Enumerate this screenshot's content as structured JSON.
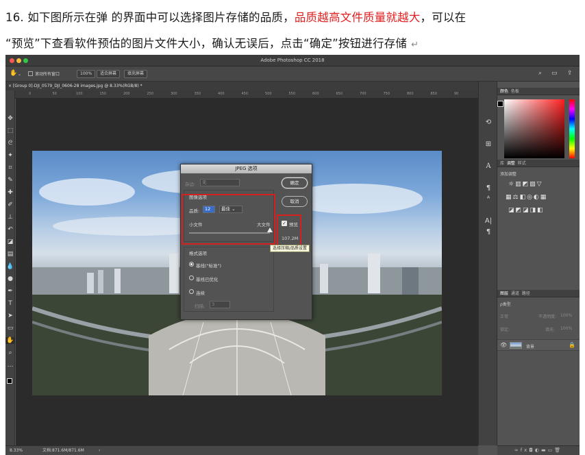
{
  "document": {
    "line1_prefix": "16. 如下图所示在弹 的界面中可以选择图片存储的品质，",
    "line1_highlight": "品质越高文件质量就越大",
    "line1_suffix": "，可以在",
    "line2": "“预览”下查看软件预估的图片文件大小，确认无误后，点击“确定”按钮进行存储",
    "return_mark": "↵",
    "highlight_color": "#e02020"
  },
  "app": {
    "window_title": "Adobe Photoshop CC 2018",
    "document_tab": "× [Group 0]-DJI_0579_DJI_0606-28 images.jpg @ 8.33%(RGB/8) *",
    "status_zoom": "8.33%",
    "status_doc": "文档:871.6M/871.6M",
    "status_arrow": "›"
  },
  "options_bar": {
    "scroll_all_label": "滚动所有窗口",
    "zoom_100": "100%",
    "fit_screen": "适合屏幕",
    "fill_screen": "填充屏幕"
  },
  "ruler": {
    "ticks": [
      "0",
      "50",
      "100",
      "150",
      "200",
      "250",
      "300",
      "350",
      "400",
      "450",
      "500",
      "550",
      "600",
      "650",
      "700",
      "750",
      "800",
      "850",
      "90"
    ]
  },
  "tools": [
    "move-icon",
    "marquee-icon",
    "lasso-icon",
    "magic-wand-icon",
    "crop-icon",
    "eyedropper-icon",
    "healing-icon",
    "brush-icon",
    "stamp-icon",
    "history-brush-icon",
    "eraser-icon",
    "gradient-icon",
    "blur-icon",
    "dodge-icon",
    "pen-icon",
    "type-icon",
    "path-select-icon",
    "shape-icon",
    "hand-icon",
    "zoom-icon",
    "more-icon"
  ],
  "jpeg_dialog": {
    "title": "JPEG 选项",
    "matte_label": "杂边:",
    "matte_value": "无",
    "ok_button": "确定",
    "cancel_button": "取消",
    "image_options_title": "图像选项",
    "quality_label": "品质:",
    "quality_value": "12",
    "quality_preset": "最佳",
    "small_file_label": "小文件",
    "large_file_label": "大文件",
    "quality_fraction": 1.0,
    "preview_label": "预览",
    "preview_checked": true,
    "file_size": "107.2M",
    "format_title": "格式选项",
    "format_baseline": "基线(\"标准\")",
    "format_optimized": "基线已优化",
    "format_progressive": "连续",
    "scan_label": "扫描:",
    "scan_value": "3"
  },
  "tooltip": "选择压缩/品质设置",
  "right_panel": {
    "color_tabs": [
      "颜色",
      "色板"
    ],
    "adjust_tabs": [
      "库",
      "调整",
      "样式"
    ],
    "add_adjustment": "添加调整",
    "layer_tabs": [
      "图层",
      "通道",
      "路径"
    ],
    "kind_label": "ρ类型",
    "blend_mode": "正常",
    "opacity_label": "不透明度:",
    "opacity_value": "100%",
    "lock_label": "锁定:",
    "fill_label": "填充:",
    "fill_value": "100%",
    "layer_name": "背景"
  }
}
